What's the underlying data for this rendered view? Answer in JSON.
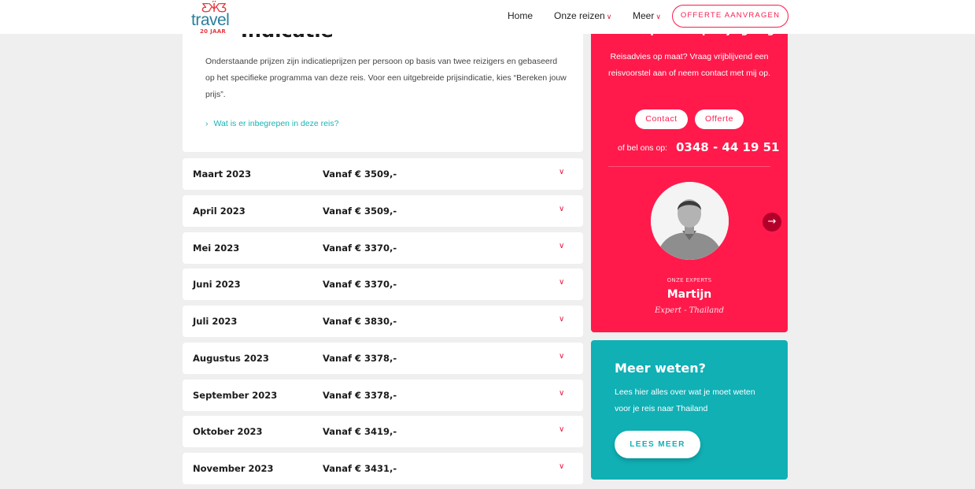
{
  "header": {
    "logo_mark": "ƸӜƷ",
    "logo_word": "travel",
    "logo_anniversary": "20 JAAR",
    "nav": [
      {
        "label": "Home"
      },
      {
        "label": "Onze reizen"
      },
      {
        "label": "Meer"
      }
    ],
    "cta_label": "OFFERTE AANVRAGEN"
  },
  "intro": {
    "title": "Indicatie",
    "text": "Onderstaande prijzen zijn indicatieprijzen per persoon op basis van twee reizigers en gebaseerd op het specifieke programma van deze reis. Voor een uitgebreide prijsindicatie, kies “Bereken jouw prijs”.",
    "link_label": "Wat is er inbegrepen in deze reis?"
  },
  "months": [
    {
      "month": "Maart 2023",
      "price": "Vanaf € 3509,-"
    },
    {
      "month": "April 2023",
      "price": "Vanaf € 3509,-"
    },
    {
      "month": "Mei 2023",
      "price": "Vanaf € 3370,-"
    },
    {
      "month": "Juni 2023",
      "price": "Vanaf € 3370,-"
    },
    {
      "month": "Juli 2023",
      "price": "Vanaf € 3830,-"
    },
    {
      "month": "Augustus 2023",
      "price": "Vanaf € 3378,-"
    },
    {
      "month": "September 2023",
      "price": "Vanaf € 3378,-"
    },
    {
      "month": "Oktober 2023",
      "price": "Vanaf € 3419,-"
    },
    {
      "month": "November 2023",
      "price": "Vanaf € 3431,-"
    }
  ],
  "expert": {
    "heading": "Onze experts helpen je graag",
    "text": "Reisadvies op maat? Vraag vrijblijvend een reisvoorstel aan of neem contact met mij op.",
    "contact_label": "Contact",
    "offerte_label": "Offerte",
    "phone_label": "of bel ons op:",
    "phone_number": "0348 - 44 19 51",
    "kicker": "ONZE EXPERTS",
    "name": "Martijn",
    "role": "Expert - Thailand"
  },
  "meer": {
    "title": "Meer weten?",
    "text": "Lees hier alles over wat je moet weten voor je reis naar Thailand",
    "button_label": "LEES MEER"
  },
  "colors": {
    "brand_red": "#ff1a4b",
    "teal": "#10b0b5",
    "background": "#efefef"
  },
  "icons": {
    "row_chevron": "chevron-down-icon",
    "next_arrow": "arrow-right-icon",
    "link_arrow": "chevron-right-icon"
  }
}
